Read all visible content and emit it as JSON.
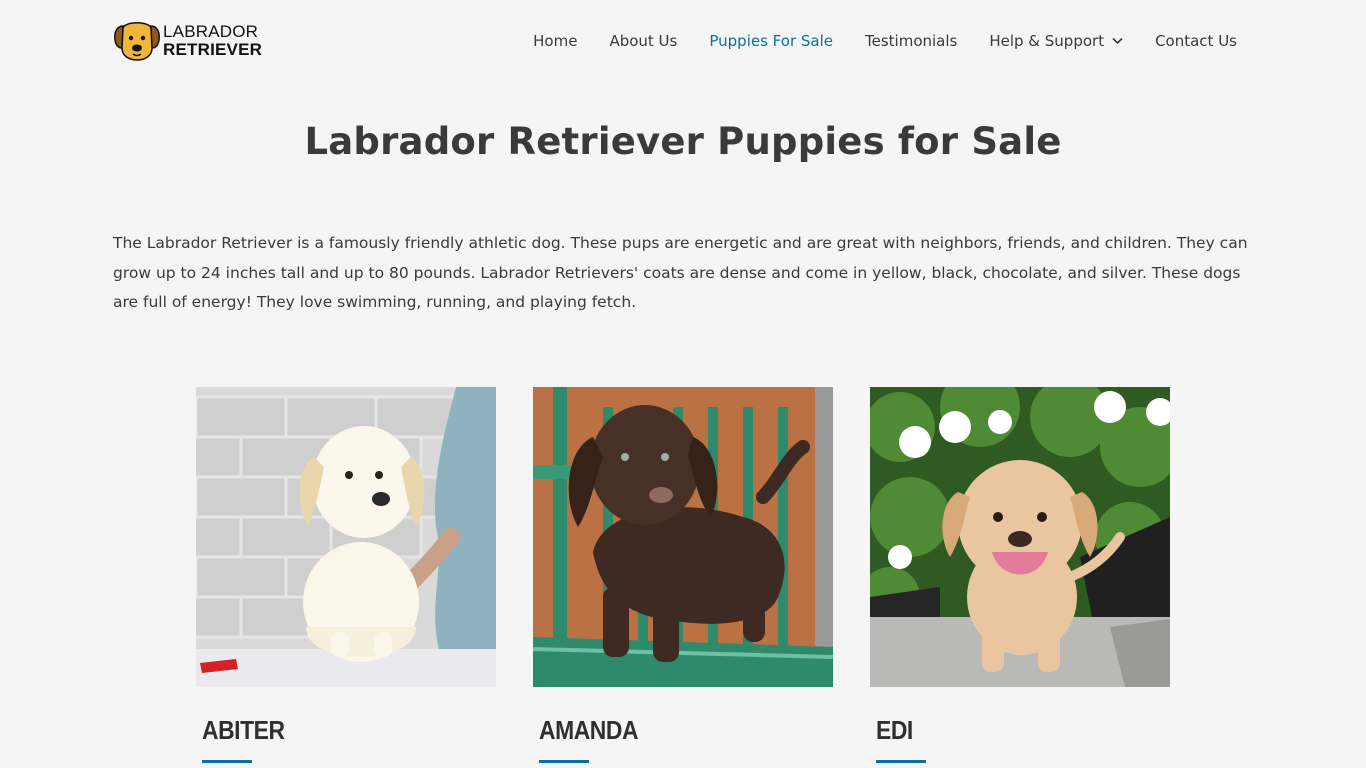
{
  "brand": {
    "line1": "LABRADOR",
    "line2": "RETRIEVER",
    "icon": "dog-face-icon"
  },
  "nav": {
    "items": [
      {
        "label": "Home",
        "active": false
      },
      {
        "label": "About Us",
        "active": false
      },
      {
        "label": "Puppies For Sale",
        "active": true
      },
      {
        "label": "Testimonials",
        "active": false
      },
      {
        "label": "Help & Support",
        "active": false,
        "dropdown": true
      },
      {
        "label": "Contact Us",
        "active": false
      }
    ]
  },
  "page": {
    "title": "Labrador Retriever Puppies for Sale",
    "intro": "The Labrador Retriever is a famously friendly athletic dog. These pups are energetic and are great with neighbors, friends, and children. They can grow up to 24 inches tall and up to 80 pounds. Labrador Retrievers' coats are dense and come in yellow, black, chocolate, and silver. These dogs are full of energy! They love swimming, running, and playing fetch."
  },
  "puppies": [
    {
      "name": "ABITER",
      "coat": "cream"
    },
    {
      "name": "AMANDA",
      "coat": "chocolate"
    },
    {
      "name": "EDI",
      "coat": "yellow"
    }
  ],
  "colors": {
    "accent": "#0b6ea6",
    "text": "#3a3a3a",
    "background": "#f5f5f5"
  }
}
